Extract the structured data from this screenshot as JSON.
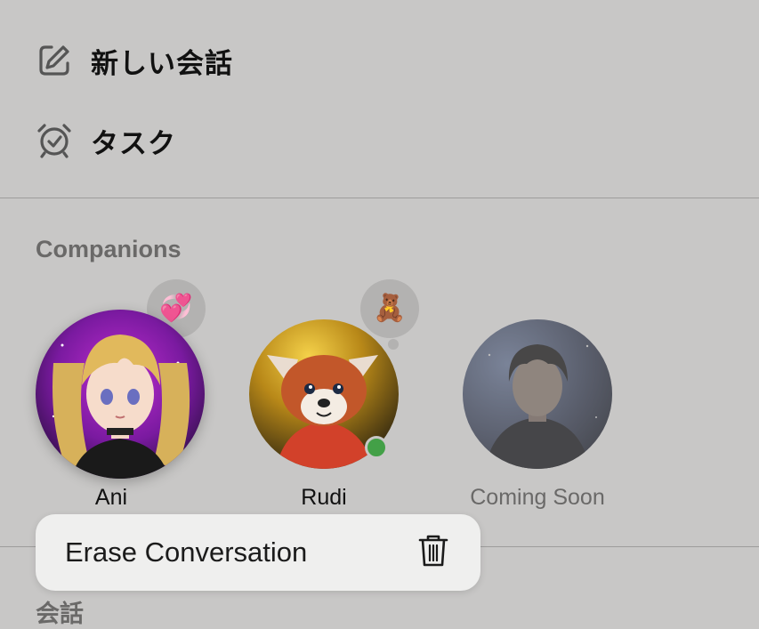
{
  "menu": {
    "new_chat_label": "新しい会話",
    "new_chat_icon": "edit-icon",
    "tasks_label": "タスク",
    "tasks_icon": "alarm-clock-icon"
  },
  "companions": {
    "title": "Companions",
    "items": [
      {
        "name": "Ani",
        "status_emoji": "💞",
        "online": false
      },
      {
        "name": "Rudi",
        "status_emoji": "🧸",
        "online": true
      },
      {
        "name": "Coming Soon",
        "status_emoji": "",
        "online": false
      }
    ]
  },
  "context_menu": {
    "erase_label": "Erase Conversation",
    "erase_icon": "trash-icon"
  },
  "conversations": {
    "title": "会話"
  },
  "colors": {
    "background": "#c8c7c6",
    "online": "#43a047",
    "section_title": "#6a6968",
    "disabled_text": "#6a6968"
  }
}
